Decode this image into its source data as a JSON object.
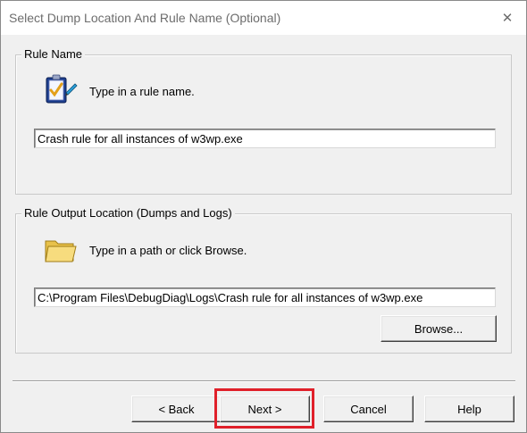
{
  "window": {
    "title": "Select Dump Location And Rule Name (Optional)",
    "close_glyph": "✕"
  },
  "rule_name_group": {
    "legend": "Rule Name",
    "icon": "clipboard-check-icon",
    "prompt": "Type in a rule name.",
    "input_value": "Crash rule for all instances of w3wp.exe"
  },
  "output_group": {
    "legend": "Rule Output Location (Dumps and Logs)",
    "icon": "folder-icon",
    "prompt": "Type in a path or click Browse.",
    "input_value": "C:\\Program Files\\DebugDiag\\Logs\\Crash rule for all instances of w3wp.exe",
    "browse_label": "Browse..."
  },
  "footer": {
    "back_label": "< Back",
    "next_label": "Next >",
    "cancel_label": "Cancel",
    "help_label": "Help"
  },
  "colors": {
    "highlight": "#e0202a",
    "title_text": "#6d6d6d"
  }
}
